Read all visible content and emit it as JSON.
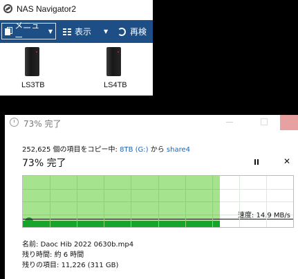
{
  "nas_window": {
    "title": "NAS Navigator2",
    "menu_label": "メニュー",
    "view_label": "表示",
    "refresh_label": "再検",
    "devices": [
      {
        "name": "LS3TB"
      },
      {
        "name": "LS4TB"
      }
    ]
  },
  "copy_dialog": {
    "title": "73% 完了",
    "summary_prefix": "252,625 個の項目をコピー中: ",
    "source": "8TB (G:)",
    "summary_mid": " から ",
    "destination": "share4",
    "progress_text": "73% 完了",
    "progress_fraction": 0.73,
    "speed_label": "速度: 14.9 MB/s",
    "name_label": "名前:",
    "name_value": "Daoc Hib 2022 0630b.mp4",
    "time_left_label": "残り時間:",
    "time_left_value": "約 6 時間",
    "items_left_label": "残りの項目:",
    "items_left_value": "11,226 (311 GB)"
  },
  "colors": {
    "toolbar_bg": "#1d4f86",
    "progress_fill": "#a6e38f",
    "speed_fill": "#16a52b",
    "link": "#1c63b7",
    "close_hover": "#e8a1a1"
  }
}
